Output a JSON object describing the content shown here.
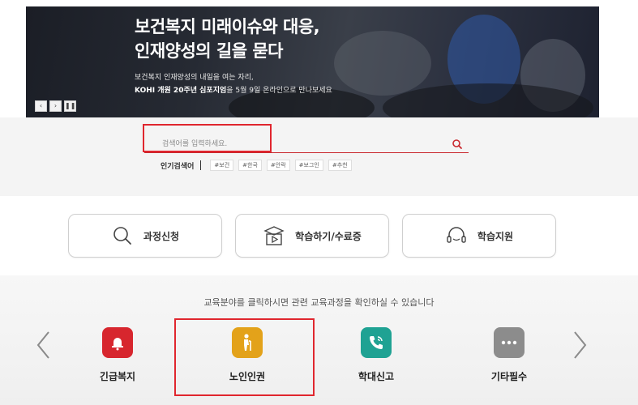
{
  "banner": {
    "title_line1": "보건복지 미래이슈와 대응,",
    "title_line2": "인재양성의 길을 묻다",
    "subtitle_line1": "보건복지 인재양성의 내일을 여는 자리,",
    "subtitle_strong": "KOHI 개원 20주년 심포지엄",
    "subtitle_rest": "을 5월 9일 온라인으로 만나보세요",
    "controls": [
      "‹",
      "›",
      "❚❚"
    ]
  },
  "search": {
    "placeholder": "검색어를 입력하세요.",
    "value": "",
    "icon": "search-icon",
    "popular_label": "인기검색어",
    "tags": [
      "#보건",
      "#한국",
      "#안락",
      "#보그인",
      "#추천"
    ]
  },
  "quick_buttons": [
    {
      "label": "과정신청",
      "icon": "magnifier-icon"
    },
    {
      "label": "학습하기/수료증",
      "icon": "graduation-play-icon"
    },
    {
      "label": "학습지원",
      "icon": "headset-icon"
    }
  ],
  "categories": {
    "hint": "교육분야를 클릭하시면 관련 교육과정을 확인하실 수 있습니다",
    "items": [
      {
        "label": "긴급복지",
        "icon": "bell-icon",
        "color": "#d7262e"
      },
      {
        "label": "노인인권",
        "icon": "elderly-person-icon",
        "color": "#e3a21a"
      },
      {
        "label": "학대신고",
        "icon": "phone-icon",
        "color": "#1fa293"
      },
      {
        "label": "기타필수",
        "icon": "more-dots-icon",
        "color": "#8c8c8c"
      }
    ]
  },
  "colors": {
    "accent": "#e0262e",
    "search_underline": "#c9272d"
  }
}
